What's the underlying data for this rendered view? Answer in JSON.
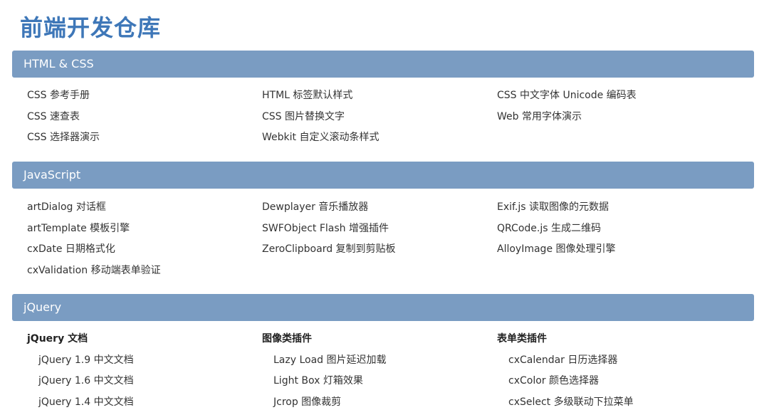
{
  "page_title": "前端开发仓库",
  "sections": [
    {
      "title": "HTML & CSS",
      "columns": [
        [
          "CSS 参考手册",
          "CSS 速查表",
          "CSS 选择器演示"
        ],
        [
          "HTML 标签默认样式",
          "CSS 图片替换文字",
          "Webkit 自定义滚动条样式"
        ],
        [
          "CSS 中文字体 Unicode 编码表",
          "Web 常用字体演示"
        ]
      ]
    },
    {
      "title": "JavaScript",
      "columns": [
        [
          "artDialog 对话框",
          "artTemplate 模板引擎",
          "cxDate 日期格式化",
          "cxValidation 移动端表单验证"
        ],
        [
          "Dewplayer 音乐播放器",
          "SWFObject Flash 增强插件",
          "ZeroClipboard 复制到剪贴板"
        ],
        [
          "Exif.js 读取图像的元数据",
          "QRCode.js 生成二维码",
          "AlloyImage 图像处理引擎"
        ]
      ]
    },
    {
      "title": "jQuery",
      "groups": [
        {
          "heading": "jQuery 文档",
          "items": [
            "jQuery 1.9 中文文档",
            "jQuery 1.6 中文文档",
            "jQuery 1.4 中文文档"
          ]
        },
        {
          "heading": "图像类插件",
          "items": [
            "Lazy Load 图片延迟加载",
            "Light Box 灯箱效果",
            "Jcrop 图像裁剪"
          ]
        },
        {
          "heading": "表单类插件",
          "items": [
            "cxCalendar 日历选择器",
            "cxColor 颜色选择器",
            "cxSelect 多级联动下拉菜单"
          ]
        }
      ]
    }
  ],
  "colors": {
    "title": "#3e77b8",
    "header_bg": "#7a9cc2",
    "header_text": "#ffffff",
    "link_text": "#333333"
  }
}
